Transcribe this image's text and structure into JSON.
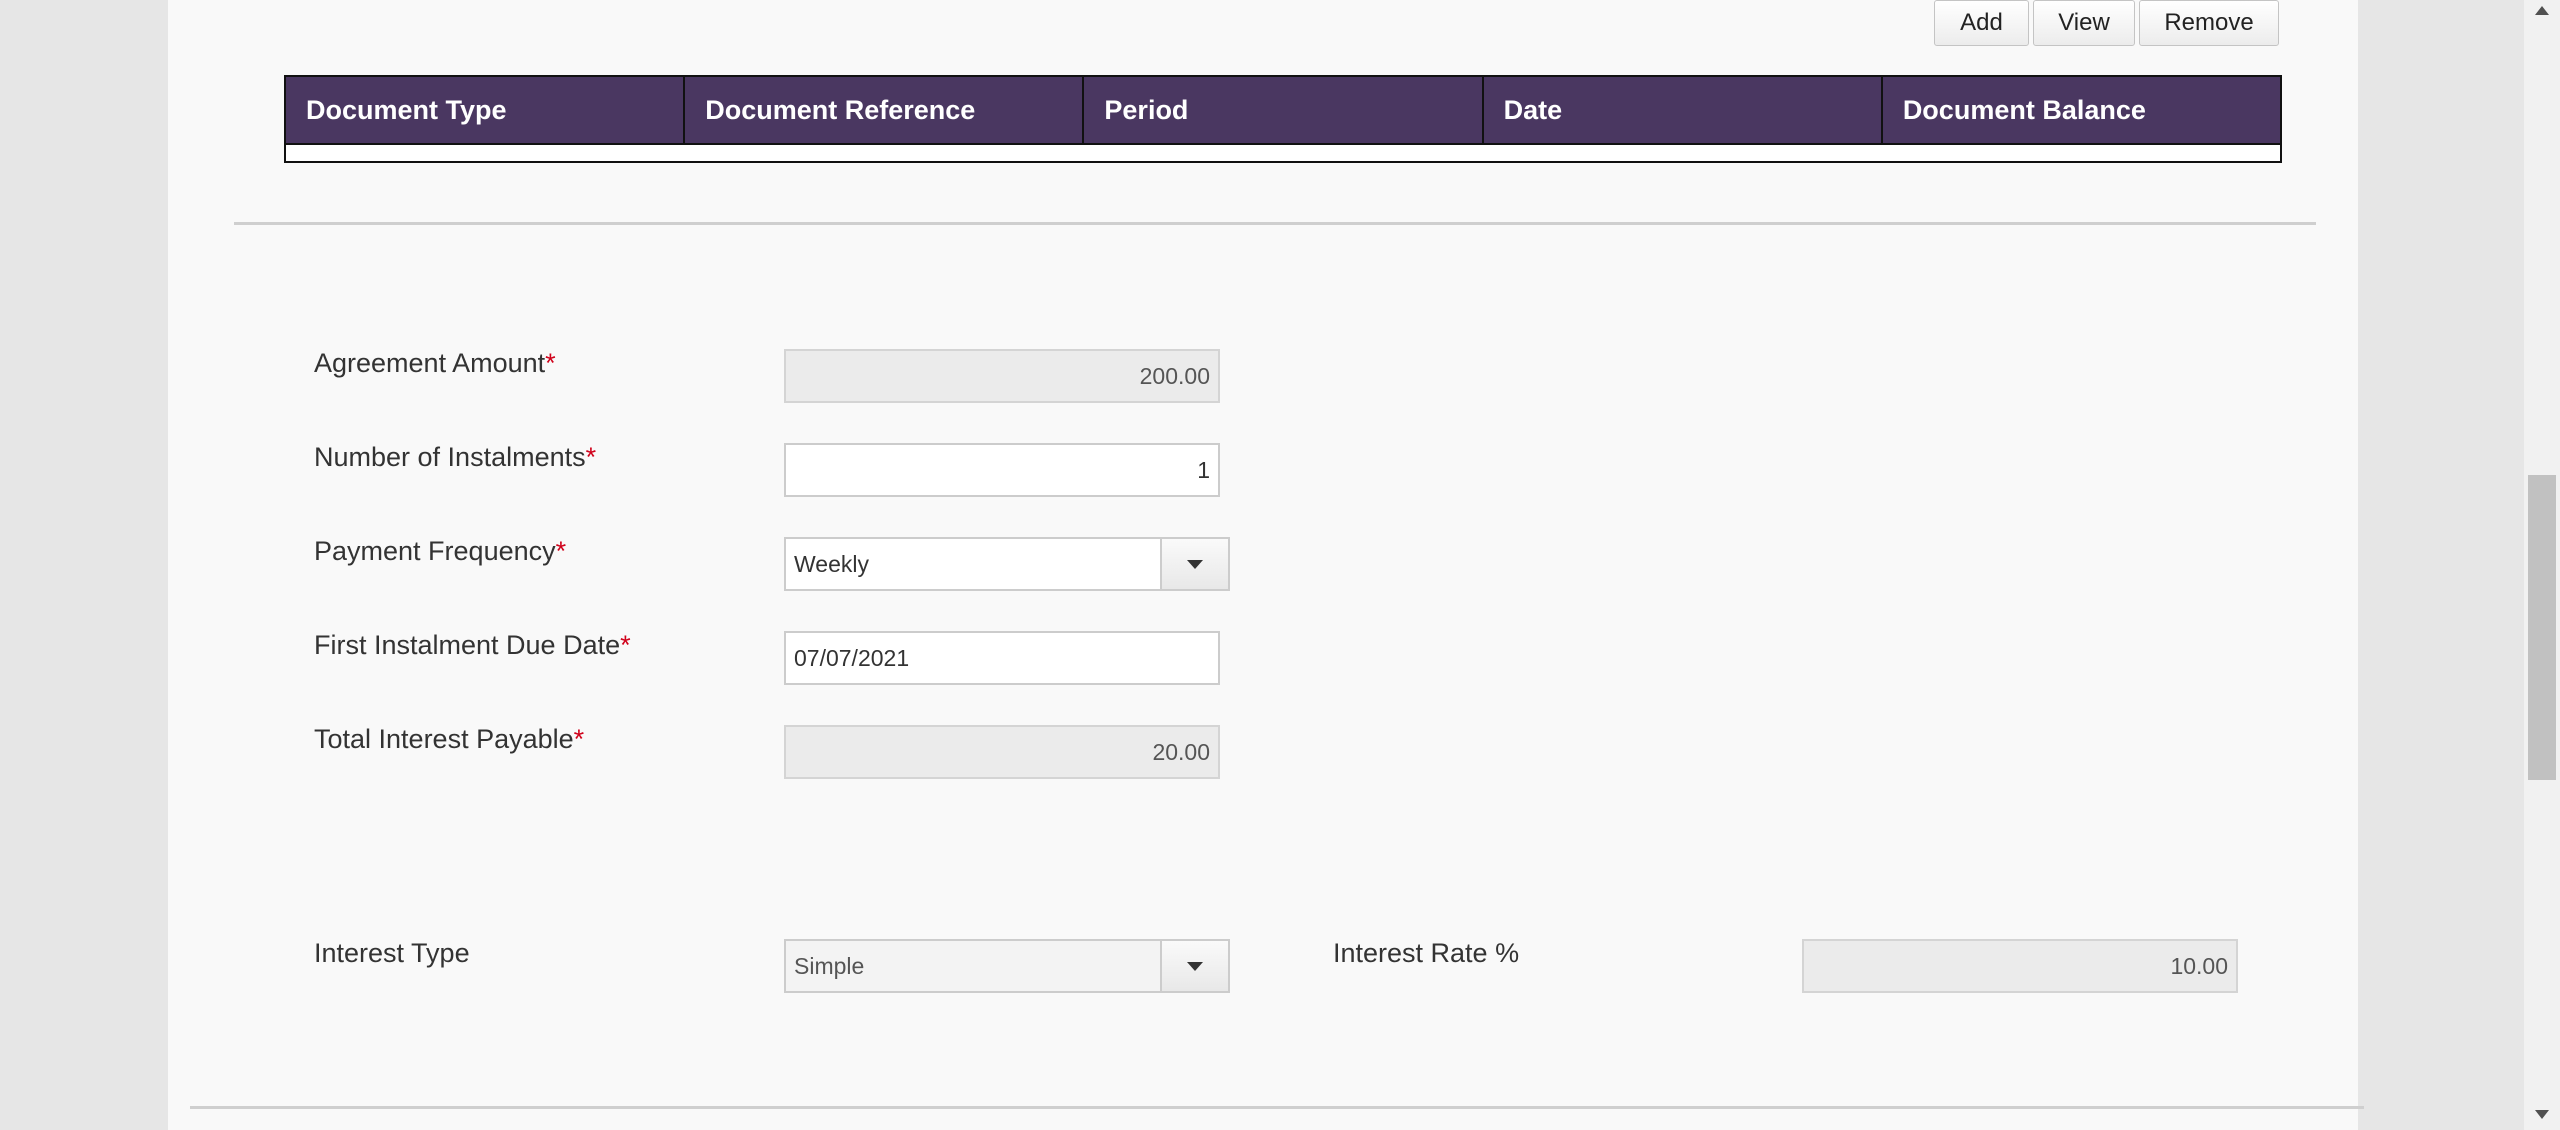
{
  "toolbar": {
    "add_label": "Add",
    "view_label": "View",
    "remove_label": "Remove"
  },
  "table": {
    "columns": [
      "Document Type",
      "Document Reference",
      "Period",
      "Date",
      "Document Balance"
    ]
  },
  "form": {
    "agreement_amount": {
      "label": "Agreement Amount",
      "required": "*",
      "value": "200.00"
    },
    "number_of_instalments": {
      "label": "Number of Instalments",
      "required": "*",
      "value": "1"
    },
    "payment_frequency": {
      "label": "Payment Frequency",
      "required": "*",
      "value": "Weekly"
    },
    "first_instalment_due_date": {
      "label": "First Instalment Due Date",
      "required": "*",
      "value": "07/07/2021"
    },
    "total_interest_payable": {
      "label": "Total Interest Payable",
      "required": "*",
      "value": "20.00"
    },
    "interest_type": {
      "label": "Interest Type",
      "value": "Simple"
    },
    "interest_rate": {
      "label": "Interest Rate %",
      "value": "10.00"
    }
  },
  "colors": {
    "table_header": "#4a3761",
    "required_marker": "#d0021b"
  }
}
